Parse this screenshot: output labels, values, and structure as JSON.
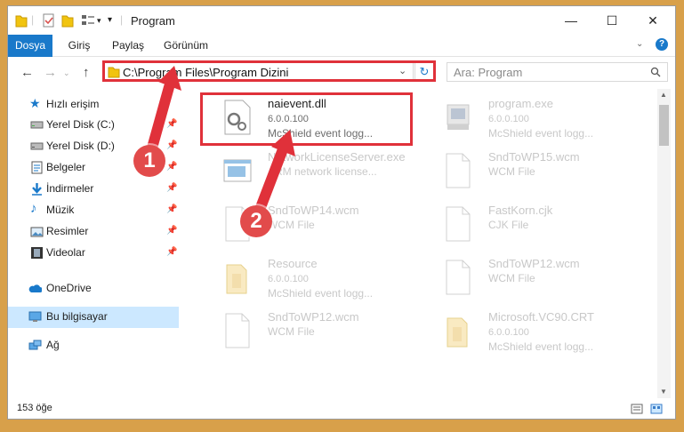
{
  "window": {
    "title": "Program"
  },
  "ribbon": {
    "tabs": [
      "Dosya",
      "Giriş",
      "Paylaş",
      "Görünüm"
    ]
  },
  "address": {
    "path": "C:\\Program Files\\Program Dizini"
  },
  "search": {
    "placeholder": "Ara: Program"
  },
  "sidebar": {
    "items": [
      {
        "label": "Hızlı erişim",
        "icon": "star-icon",
        "pinned": false
      },
      {
        "label": "Yerel Disk (C:)",
        "icon": "drive-icon",
        "pinned": true
      },
      {
        "label": "Yerel Disk (D:)",
        "icon": "drive-icon",
        "pinned": true
      },
      {
        "label": "Belgeler",
        "icon": "documents-icon",
        "pinned": true
      },
      {
        "label": "İndirmeler",
        "icon": "download-icon",
        "pinned": true
      },
      {
        "label": "Müzik",
        "icon": "music-icon",
        "pinned": true
      },
      {
        "label": "Resimler",
        "icon": "pictures-icon",
        "pinned": true
      },
      {
        "label": "Videolar",
        "icon": "video-icon",
        "pinned": true
      },
      {
        "label": "OneDrive",
        "icon": "cloud-icon",
        "pinned": false
      },
      {
        "label": "Bu bilgisayar",
        "icon": "computer-icon",
        "pinned": false
      },
      {
        "label": "Ağ",
        "icon": "network-icon",
        "pinned": false
      }
    ]
  },
  "files": [
    {
      "name": "naievent.dll",
      "line1": "6.0.0.100",
      "line2": "McShield event logg...",
      "icon": "dll-icon"
    },
    {
      "name": "program.exe",
      "line1": "6.0.0.100",
      "line2": "McShield event logg...",
      "icon": "exe-icon"
    },
    {
      "name": "NetworkLicenseServer.exe",
      "line1": "",
      "line2": "ARM network license...",
      "icon": "exe-icon"
    },
    {
      "name": "SndToWP15.wcm",
      "line1": "",
      "line2": "WCM File",
      "icon": "document-icon"
    },
    {
      "name": "SndToWP14.wcm",
      "line1": "",
      "line2": "WCM File",
      "icon": "document-icon"
    },
    {
      "name": "FastKorn.cjk",
      "line1": "",
      "line2": "CJK File",
      "icon": "document-icon"
    },
    {
      "name": "Resource",
      "line1": "6.0.0.100",
      "line2": "McShield event logg...",
      "icon": "folder-file-icon"
    },
    {
      "name": "SndToWP12.wcm",
      "line1": "",
      "line2": "WCM File",
      "icon": "document-icon"
    },
    {
      "name": "SndToWP12.wcm",
      "line1": "",
      "line2": "WCM File",
      "icon": "document-icon"
    },
    {
      "name": "Microsoft.VC90.CRT",
      "line1": "6.0.0.100",
      "line2": "McShield event logg...",
      "icon": "folder-file-icon"
    }
  ],
  "status": {
    "count": "153 öğe"
  },
  "callouts": {
    "one": "1",
    "two": "2"
  },
  "colors": {
    "accent": "#1979ca",
    "highlight": "#e0313a",
    "selection": "#cce8ff"
  }
}
